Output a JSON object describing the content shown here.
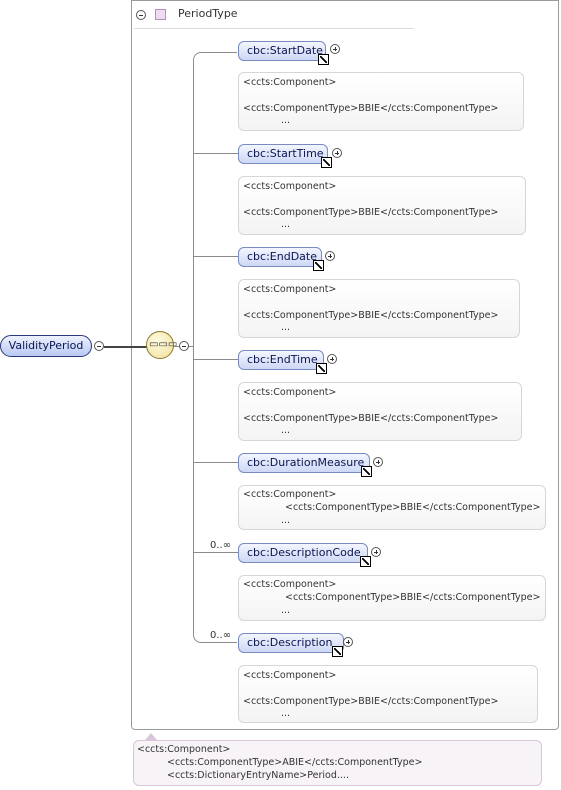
{
  "type_box": {
    "title": "PeriodType"
  },
  "root_element": {
    "label": "ValidityPeriod"
  },
  "elements": [
    {
      "label": "cbc:StartDate",
      "occurrence": "",
      "annotation": [
        "<ccts:Component>",
        "<ccts:ComponentType>BBIE</ccts:ComponentType>",
        "..."
      ]
    },
    {
      "label": "cbc:StartTime",
      "occurrence": "",
      "annotation": [
        "<ccts:Component>",
        "<ccts:ComponentType>BBIE</ccts:ComponentType>",
        "..."
      ]
    },
    {
      "label": "cbc:EndDate",
      "occurrence": "",
      "annotation": [
        "<ccts:Component>",
        "<ccts:ComponentType>BBIE</ccts:ComponentType>",
        "..."
      ]
    },
    {
      "label": "cbc:EndTime",
      "occurrence": "",
      "annotation": [
        "<ccts:Component>",
        "<ccts:ComponentType>BBIE</ccts:ComponentType>",
        "..."
      ]
    },
    {
      "label": "cbc:DurationMeasure",
      "occurrence": "",
      "annotation": [
        "<ccts:Component>",
        "<ccts:ComponentType>BBIE</ccts:ComponentType>",
        "..."
      ]
    },
    {
      "label": "cbc:DescriptionCode",
      "occurrence": "0..∞",
      "annotation": [
        "<ccts:Component>",
        "<ccts:ComponentType>BBIE</ccts:ComponentType>",
        "..."
      ]
    },
    {
      "label": "cbc:Description",
      "occurrence": "0..∞",
      "annotation": [
        "<ccts:Component>",
        "<ccts:ComponentType>BBIE</ccts:ComponentType>",
        "..."
      ]
    }
  ],
  "root_annotation": [
    "<ccts:Component>",
    "<ccts:ComponentType>ABIE</ccts:ComponentType>",
    "<ccts:DictionaryEntryName>Period...."
  ]
}
